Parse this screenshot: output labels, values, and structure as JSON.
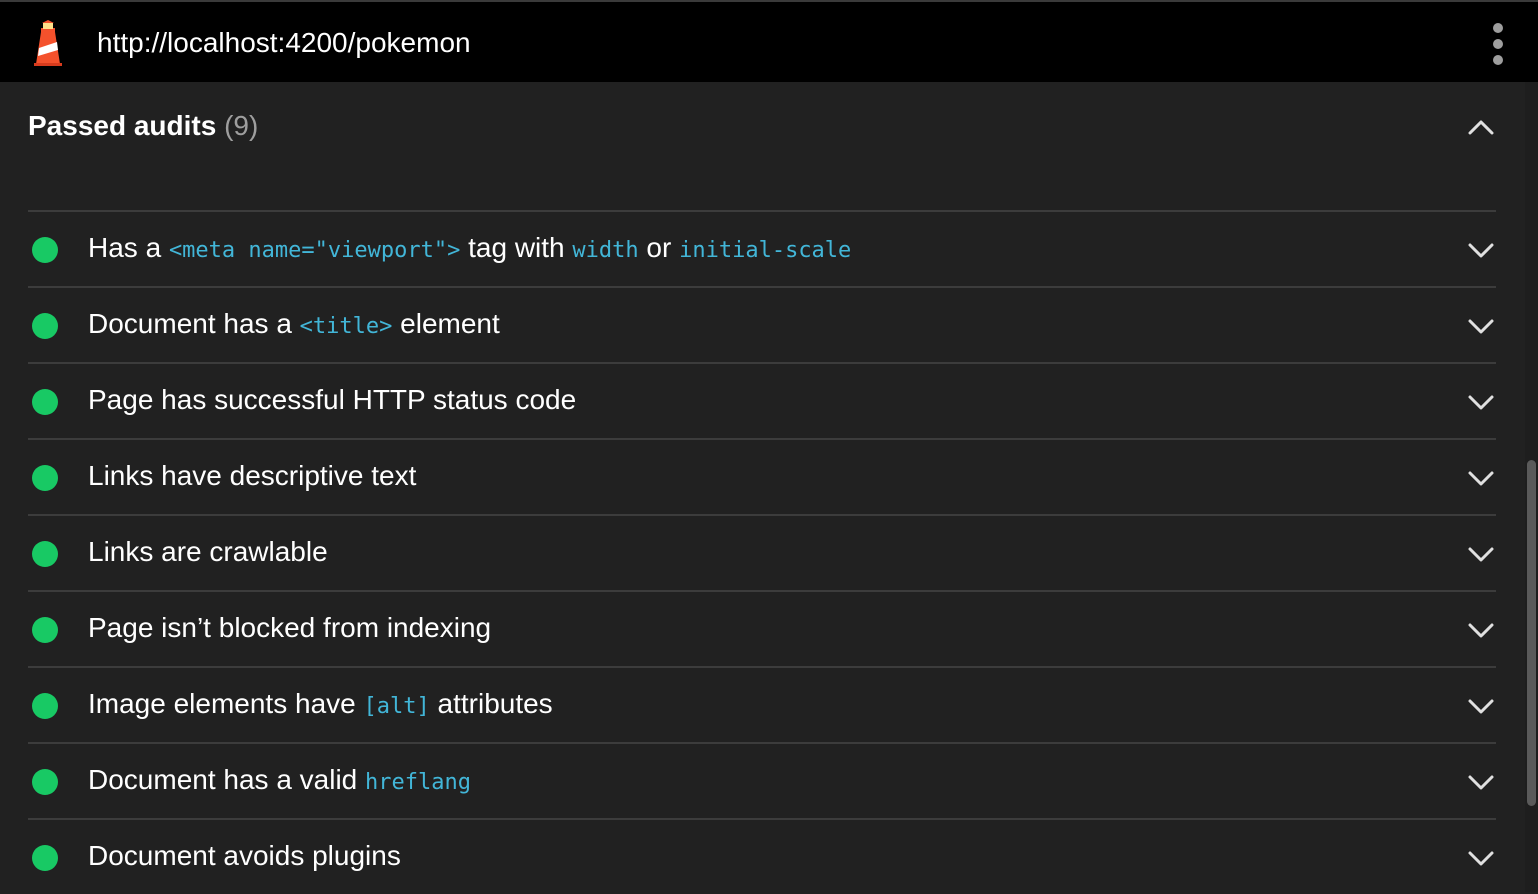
{
  "browser": {
    "url": "http://localhost:4200/pokemon",
    "logo_icon": "lighthouse-icon",
    "menu_icon": "kebab-menu-icon"
  },
  "section": {
    "title": "Passed audits",
    "count": "(9)",
    "collapse_icon": "chevron-up-icon"
  },
  "colors": {
    "background": "#212121",
    "topbar": "#000000",
    "pass": "#18c964",
    "code": "#42b6d8",
    "divider": "#3c3c3c"
  },
  "audits": [
    {
      "t0": "Has a ",
      "c0": "<meta name=\"viewport\">",
      "t1": " tag with ",
      "c1": "width",
      "t2": " or ",
      "c2": "initial-scale",
      "t3": ""
    },
    {
      "t0": "Document has a ",
      "c0": "<title>",
      "t1": " element",
      "c1": "",
      "t2": "",
      "c2": "",
      "t3": ""
    },
    {
      "t0": "Page has successful HTTP status code",
      "c0": "",
      "t1": "",
      "c1": "",
      "t2": "",
      "c2": "",
      "t3": ""
    },
    {
      "t0": "Links have descriptive text",
      "c0": "",
      "t1": "",
      "c1": "",
      "t2": "",
      "c2": "",
      "t3": ""
    },
    {
      "t0": "Links are crawlable",
      "c0": "",
      "t1": "",
      "c1": "",
      "t2": "",
      "c2": "",
      "t3": ""
    },
    {
      "t0": "Page isn’t blocked from indexing",
      "c0": "",
      "t1": "",
      "c1": "",
      "t2": "",
      "c2": "",
      "t3": ""
    },
    {
      "t0": "Image elements have ",
      "c0": "[alt]",
      "t1": " attributes",
      "c1": "",
      "t2": "",
      "c2": "",
      "t3": ""
    },
    {
      "t0": "Document has a valid ",
      "c0": "hreflang",
      "t1": "",
      "c1": "",
      "t2": "",
      "c2": "",
      "t3": ""
    },
    {
      "t0": "Document avoids plugins",
      "c0": "",
      "t1": "",
      "c1": "",
      "t2": "",
      "c2": "",
      "t3": ""
    }
  ]
}
